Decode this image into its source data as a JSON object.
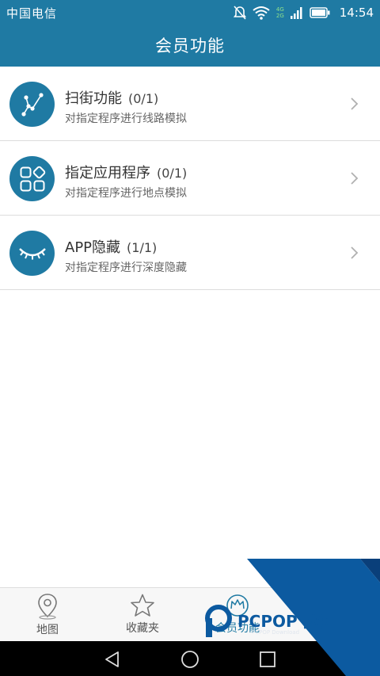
{
  "status_bar": {
    "carrier": "中国电信",
    "net_top": "4G",
    "net_bottom": "2G",
    "time": "14:54",
    "icons": [
      "mute-icon",
      "wifi-icon",
      "signal-icon",
      "battery-icon"
    ]
  },
  "header": {
    "title": "会员功能"
  },
  "list": {
    "items": [
      {
        "title": "扫街功能",
        "count": "(0/1)",
        "subtitle": "对指定程序进行线路模拟",
        "icon": "route-icon"
      },
      {
        "title": "指定应用程序",
        "count": "(0/1)",
        "subtitle": "对指定程序进行地点模拟",
        "icon": "apps-grid-icon"
      },
      {
        "title": "APP隐藏",
        "count": "(1/1)",
        "subtitle": "对指定程序进行深度隐藏",
        "icon": "closed-eye-icon"
      }
    ]
  },
  "tab_bar": {
    "tabs": [
      {
        "label": "地图",
        "icon": "map-pin-icon"
      },
      {
        "label": "收藏夹",
        "icon": "star-icon"
      },
      {
        "label": "会员功能",
        "icon": "crown-icon",
        "active": true
      }
    ]
  },
  "nav_bar": {
    "buttons": [
      "back-icon",
      "home-icon",
      "recents-icon"
    ]
  },
  "watermark": {
    "text": "PCPOP下载",
    "subtext": "PCPOP Download"
  },
  "colors": {
    "primary": "#1f7aa3",
    "watermark_blue": "#0c5aa0",
    "watermark_dark": "#0a3f7a"
  }
}
